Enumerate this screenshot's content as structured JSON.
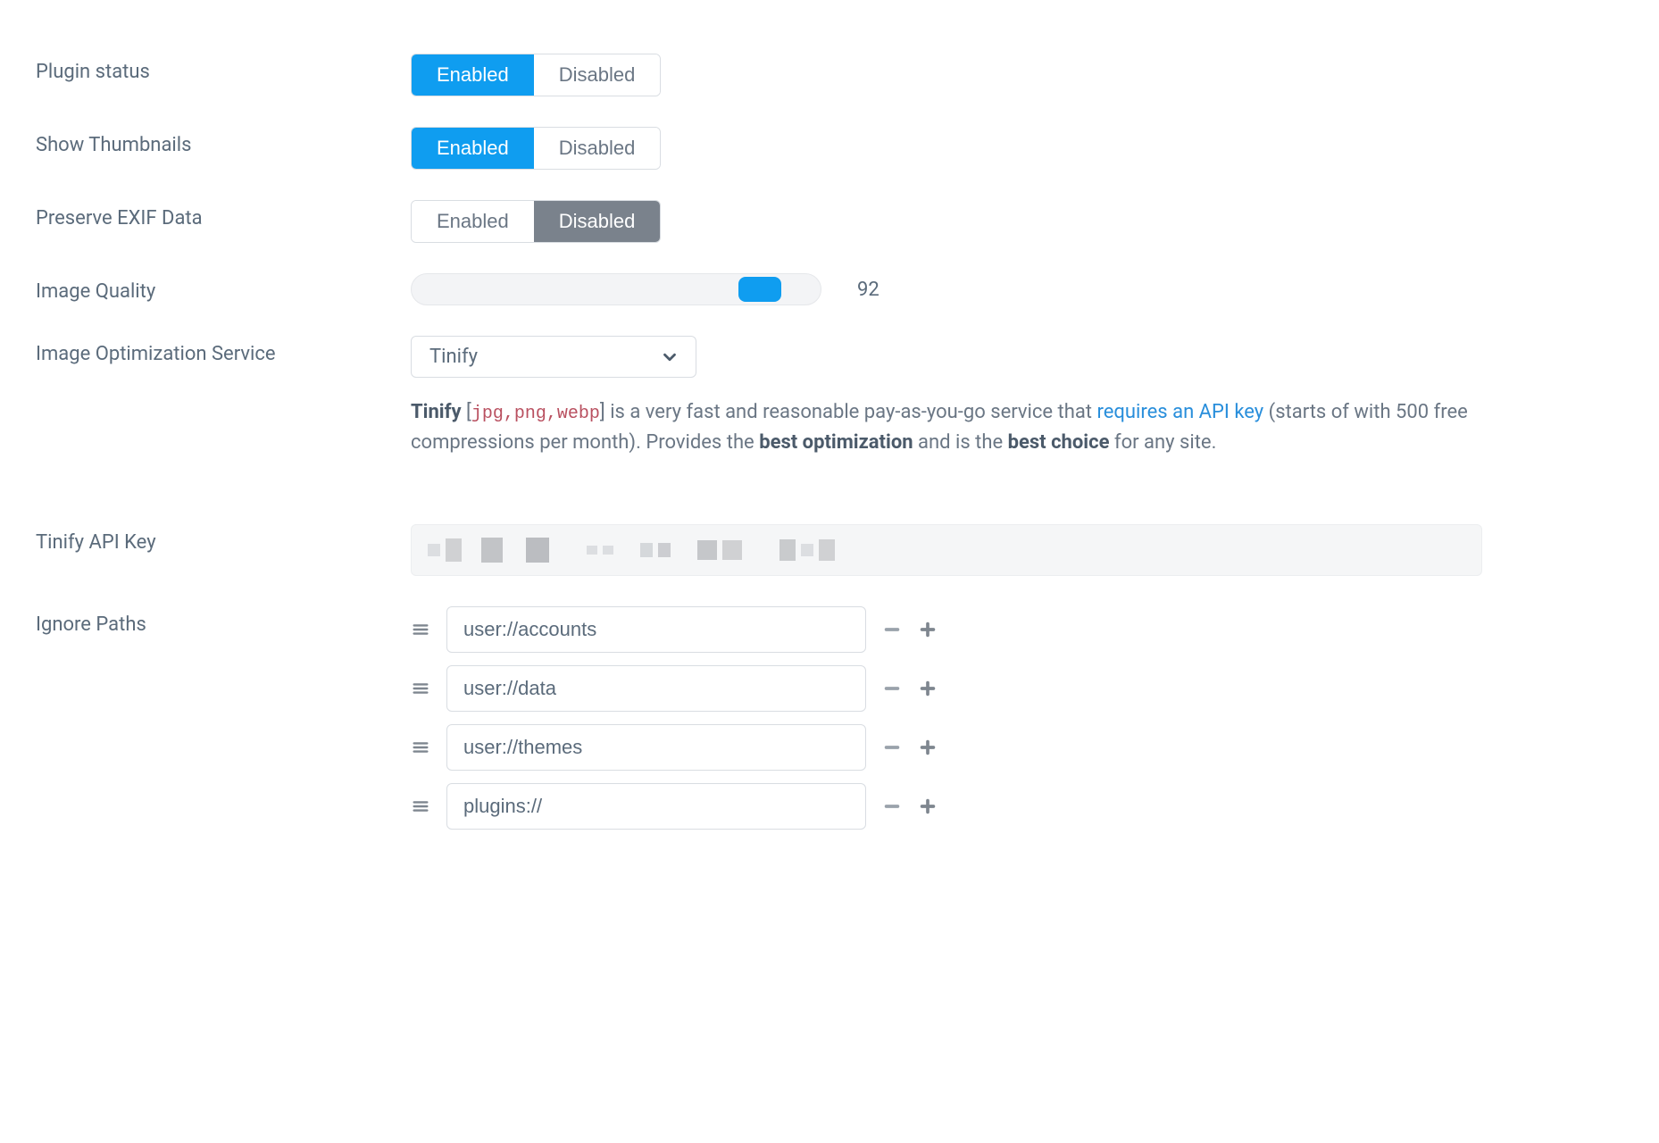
{
  "labels": {
    "plugin_status": "Plugin status",
    "show_thumbnails": "Show Thumbnails",
    "preserve_exif": "Preserve EXIF Data",
    "image_quality": "Image Quality",
    "optimization_service": "Image Optimization Service",
    "api_key": "Tinify API Key",
    "ignore_paths": "Ignore Paths"
  },
  "toggle_options": {
    "enabled": "Enabled",
    "disabled": "Disabled"
  },
  "plugin_status": {
    "value": "Enabled"
  },
  "show_thumbnails": {
    "value": "Enabled"
  },
  "preserve_exif": {
    "value": "Disabled"
  },
  "image_quality": {
    "value": "92"
  },
  "optimization_service": {
    "selected": "Tinify"
  },
  "description": {
    "strong1": "Tinify",
    "brOpen": " [",
    "formats": "jpg,png,webp",
    "brClose": "] ",
    "part1": "is a very fast and reasonable pay-as-you-go service that ",
    "link": "requires an API key",
    "part2": " (starts of with 500 free compressions per month). Provides the ",
    "strong2": "best optimization",
    "part3": " and is the ",
    "strong3": "best choice",
    "part4": " for any site."
  },
  "ignore_paths": {
    "items": [
      "user://accounts",
      "user://data",
      "user://themes",
      "plugins://"
    ]
  }
}
